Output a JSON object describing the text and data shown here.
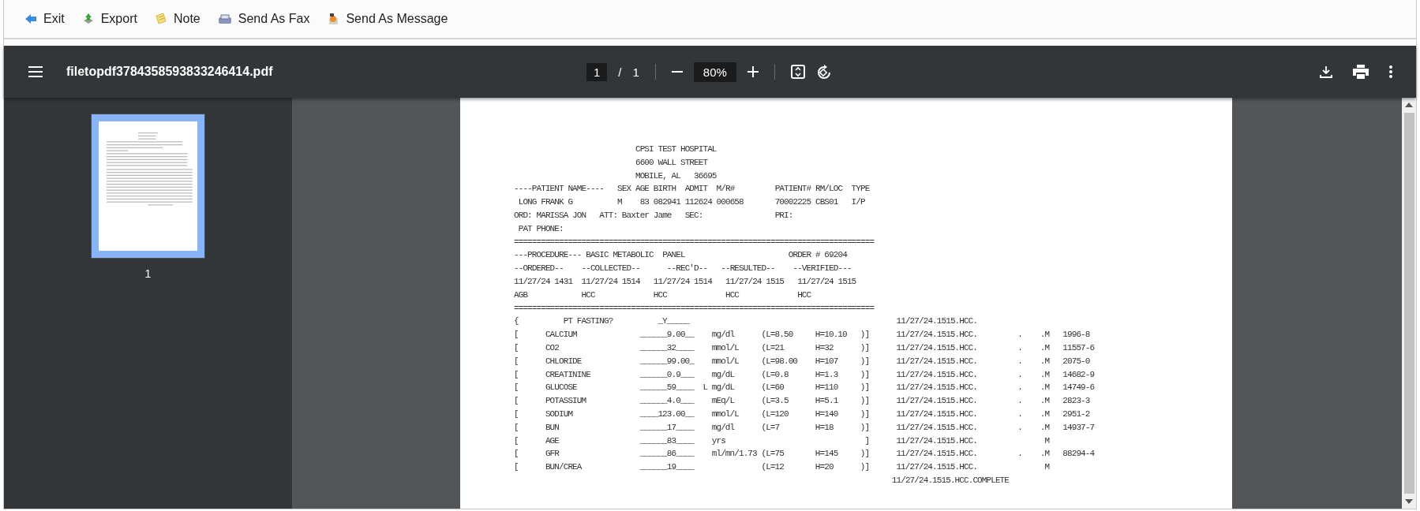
{
  "toolbar": {
    "buttons": [
      {
        "label": "Exit",
        "kind": "exit"
      },
      {
        "label": "Export",
        "kind": "export"
      },
      {
        "label": "Note",
        "kind": "note"
      },
      {
        "label": "Send As Fax",
        "kind": "fax"
      },
      {
        "label": "Send As Message",
        "kind": "message"
      }
    ]
  },
  "viewer": {
    "filename": "filetopdf3784358593833246414.pdf",
    "page_input": "1",
    "page_separator": "/",
    "page_total": "1",
    "zoom": "80%"
  },
  "sidebar": {
    "thumbnails": [
      {
        "label": "1",
        "selected": true
      }
    ]
  },
  "document": {
    "header_lines": [
      "                           CPSI TEST HOSPITAL",
      "                           6600 WALL STREET",
      "                           MOBILE, AL   36695",
      "----PATIENT NAME----   SEX AGE BIRTH  ADMIT  M/R#         PATIENT# RM/LOC  TYPE",
      " LONG FRANK G          M    83 082941 112624 000658       70002225 CBS01   I/P",
      "ORD: MARISSA JON   ATT: Baxter Jame   SEC:                PRI:",
      " PAT PHONE:",
      "================================================================================",
      "---PROCEDURE--- BASIC METABOLIC  PANEL                       ORDER # 69204",
      "--ORDERED--    --COLLECTED--      --REC'D--   --RESULTED--    --VERIFIED---",
      "11/27/24 1431  11/27/24 1514   11/27/24 1514   11/27/24 1515   11/27/24 1515",
      "AGB            HCC             HCC             HCC             HCC",
      "================================================================================"
    ],
    "results": [
      {
        "kind": "question",
        "bracket": "{",
        "name": "PT FASTING?",
        "value": "_Y_____",
        "stamp": "11/27/24.1515.HCC."
      },
      {
        "kind": "test",
        "bracket": "[",
        "name": "CALCIUM",
        "value": "______9.00__",
        "units": "mg/dl",
        "low": "(L=8.50",
        "high": "H=10.10",
        "close": ")]",
        "stamp": "11/27/24.1515.HCC.",
        "dot": ".",
        "mark": ".M",
        "code": "1996-8"
      },
      {
        "kind": "test",
        "bracket": "[",
        "name": "CO2",
        "value": "______32____",
        "units": "mmol/L",
        "low": "(L=21",
        "high": "H=32",
        "close": ")]",
        "stamp": "11/27/24.1515.HCC.",
        "dot": ".",
        "mark": ".M",
        "code": "11557-6"
      },
      {
        "kind": "test",
        "bracket": "[",
        "name": "CHLORIDE",
        "value": "______99.00_",
        "units": "mmol/L",
        "low": "(L=98.00",
        "high": "H=107",
        "close": ")]",
        "stamp": "11/27/24.1515.HCC.",
        "dot": ".",
        "mark": ".M",
        "code": "2075-0"
      },
      {
        "kind": "test",
        "bracket": "[",
        "name": "CREATININE",
        "value": "______0.9___",
        "units": "mg/dL",
        "low": "(L=0.8",
        "high": "H=1.3",
        "close": ")]",
        "stamp": "11/27/24.1515.HCC.",
        "dot": ".",
        "mark": ".M",
        "code": "14682-9"
      },
      {
        "kind": "test",
        "bracket": "[",
        "name": "GLUCOSE",
        "value": "______59____",
        "flag": "L",
        "units": "mg/dL",
        "low": "(L=60",
        "high": "H=110",
        "close": ")]",
        "stamp": "11/27/24.1515.HCC.",
        "dot": ".",
        "mark": ".M",
        "code": "14749-6"
      },
      {
        "kind": "test",
        "bracket": "[",
        "name": "POTASSIUM",
        "value": "______4.0___",
        "units": "mEq/L",
        "low": "(L=3.5",
        "high": "H=5.1",
        "close": ")]",
        "stamp": "11/27/24.1515.HCC.",
        "dot": ".",
        "mark": ".M",
        "code": "2823-3"
      },
      {
        "kind": "test",
        "bracket": "[",
        "name": "SODIUM",
        "value": "____123.00__",
        "units": "mmol/L",
        "low": "(L=120",
        "high": "H=140",
        "close": ")]",
        "stamp": "11/27/24.1515.HCC.",
        "dot": ".",
        "mark": ".M",
        "code": "2951-2"
      },
      {
        "kind": "test",
        "bracket": "[",
        "name": "BUN",
        "value": "______17____",
        "units": "mg/dl",
        "low": "(L=7",
        "high": "H=18",
        "close": ")]",
        "stamp": "11/27/24.1515.HCC.",
        "dot": ".",
        "mark": ".M",
        "code": "14937-7"
      },
      {
        "kind": "test",
        "bracket": "[",
        "name": "AGE",
        "value": "______83____",
        "units": "yrs",
        "close": "]",
        "stamp": "11/27/24.1515.HCC.",
        "mark": "M"
      },
      {
        "kind": "test",
        "bracket": "[",
        "name": "GFR",
        "value": "______86____",
        "units": "ml/mn/1.73",
        "low": "(L=75",
        "high": "H=145",
        "close": ")]",
        "stamp": "11/27/24.1515.HCC.",
        "dot": ".",
        "mark": ".M",
        "code": "88294-4"
      },
      {
        "kind": "test",
        "bracket": "[",
        "name": "BUN/CREA",
        "value": "______19____",
        "low": "(L=12",
        "high": "H=20",
        "close": ")]",
        "stamp": "11/27/24.1515.HCC.",
        "mark": "M"
      },
      {
        "kind": "stamp",
        "stamp": "11/27/24.1515.HCC.COMPLETE"
      }
    ]
  }
}
